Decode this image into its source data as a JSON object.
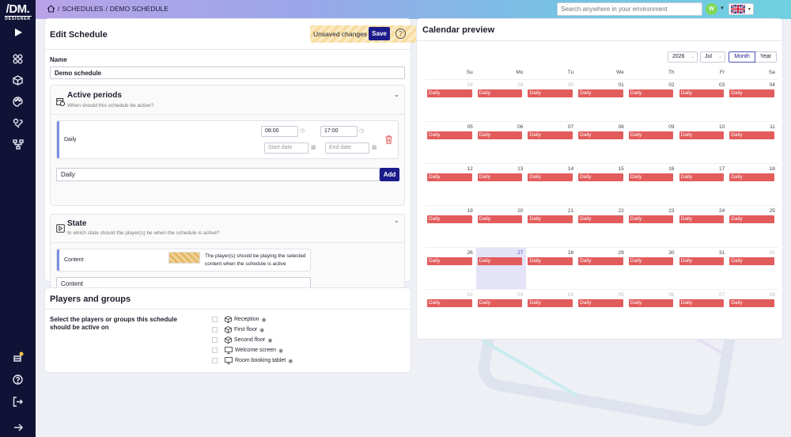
{
  "brand": {
    "logo_main": "/DM.",
    "logo_sub": "DESIGNER"
  },
  "breadcrumb": {
    "sep1": "/",
    "item1": "SCHEDULES",
    "sep2": "/",
    "item2": "DEMO SCHEDULE"
  },
  "search": {
    "placeholder": "Search anywhere in your environment"
  },
  "user": {
    "initial": "W"
  },
  "edit": {
    "title": "Edit Schedule",
    "unsaved_label": "Unsaved changes",
    "save_label": "Save",
    "help_label": "?",
    "name_label": "Name",
    "name_value": "Demo schedule"
  },
  "active_periods": {
    "title": "Active periods",
    "subtitle": "When should this schedule be active?",
    "period": {
      "name": "Daily",
      "start_time": "08:00",
      "end_time": "17:00",
      "start_date_placeholder": "Start date",
      "end_date_placeholder": "End date"
    },
    "select_value": "Daily",
    "add_label": "Add"
  },
  "state": {
    "title": "State",
    "subtitle": "In which state should the player(s) be when the schedule is active?",
    "item_name": "Content",
    "item_description": "The player(s) should be playing the selected content when the schedule is active",
    "select_value": "Content"
  },
  "players": {
    "title": "Players and groups",
    "description": "Select the players or groups this schedule should be active on",
    "items": [
      {
        "label": "Reception",
        "icon": "cube-icon"
      },
      {
        "label": "First floor",
        "icon": "cube-icon"
      },
      {
        "label": "Second floor",
        "icon": "cube-icon"
      },
      {
        "label": "Welcome screen",
        "icon": "monitor-icon"
      },
      {
        "label": "Room booking tablet",
        "icon": "monitor-icon"
      }
    ]
  },
  "calendar": {
    "title": "Calendar preview",
    "year": "2026",
    "month": "Jul",
    "view_month": "Month",
    "view_year": "Year",
    "weekdays": [
      "Su",
      "Mo",
      "Tu",
      "We",
      "Th",
      "Fr",
      "Sa"
    ],
    "event_label": "Daily",
    "today": "27",
    "weeks": [
      [
        {
          "d": "28",
          "dim": true
        },
        {
          "d": "29",
          "dim": true
        },
        {
          "d": "30",
          "dim": true
        },
        {
          "d": "01"
        },
        {
          "d": "02"
        },
        {
          "d": "03"
        },
        {
          "d": "04"
        }
      ],
      [
        {
          "d": "05"
        },
        {
          "d": "06"
        },
        {
          "d": "07"
        },
        {
          "d": "08"
        },
        {
          "d": "09"
        },
        {
          "d": "10"
        },
        {
          "d": "11"
        }
      ],
      [
        {
          "d": "12"
        },
        {
          "d": "13"
        },
        {
          "d": "14"
        },
        {
          "d": "15"
        },
        {
          "d": "16"
        },
        {
          "d": "17"
        },
        {
          "d": "18"
        }
      ],
      [
        {
          "d": "19"
        },
        {
          "d": "20"
        },
        {
          "d": "21"
        },
        {
          "d": "22"
        },
        {
          "d": "23"
        },
        {
          "d": "24"
        },
        {
          "d": "25"
        }
      ],
      [
        {
          "d": "26"
        },
        {
          "d": "27",
          "today": true
        },
        {
          "d": "28"
        },
        {
          "d": "29"
        },
        {
          "d": "30"
        },
        {
          "d": "31"
        },
        {
          "d": "01",
          "dim": true
        }
      ],
      [
        {
          "d": "02",
          "dim": true
        },
        {
          "d": "03",
          "dim": true
        },
        {
          "d": "04",
          "dim": true
        },
        {
          "d": "05",
          "dim": true
        },
        {
          "d": "06",
          "dim": true
        },
        {
          "d": "07",
          "dim": true
        },
        {
          "d": "08",
          "dim": true
        }
      ]
    ]
  },
  "colors": {
    "accent": "#1c1b8a",
    "event": "#e25c5c",
    "sidebar": "#111336",
    "today": "#e4e3f7"
  }
}
